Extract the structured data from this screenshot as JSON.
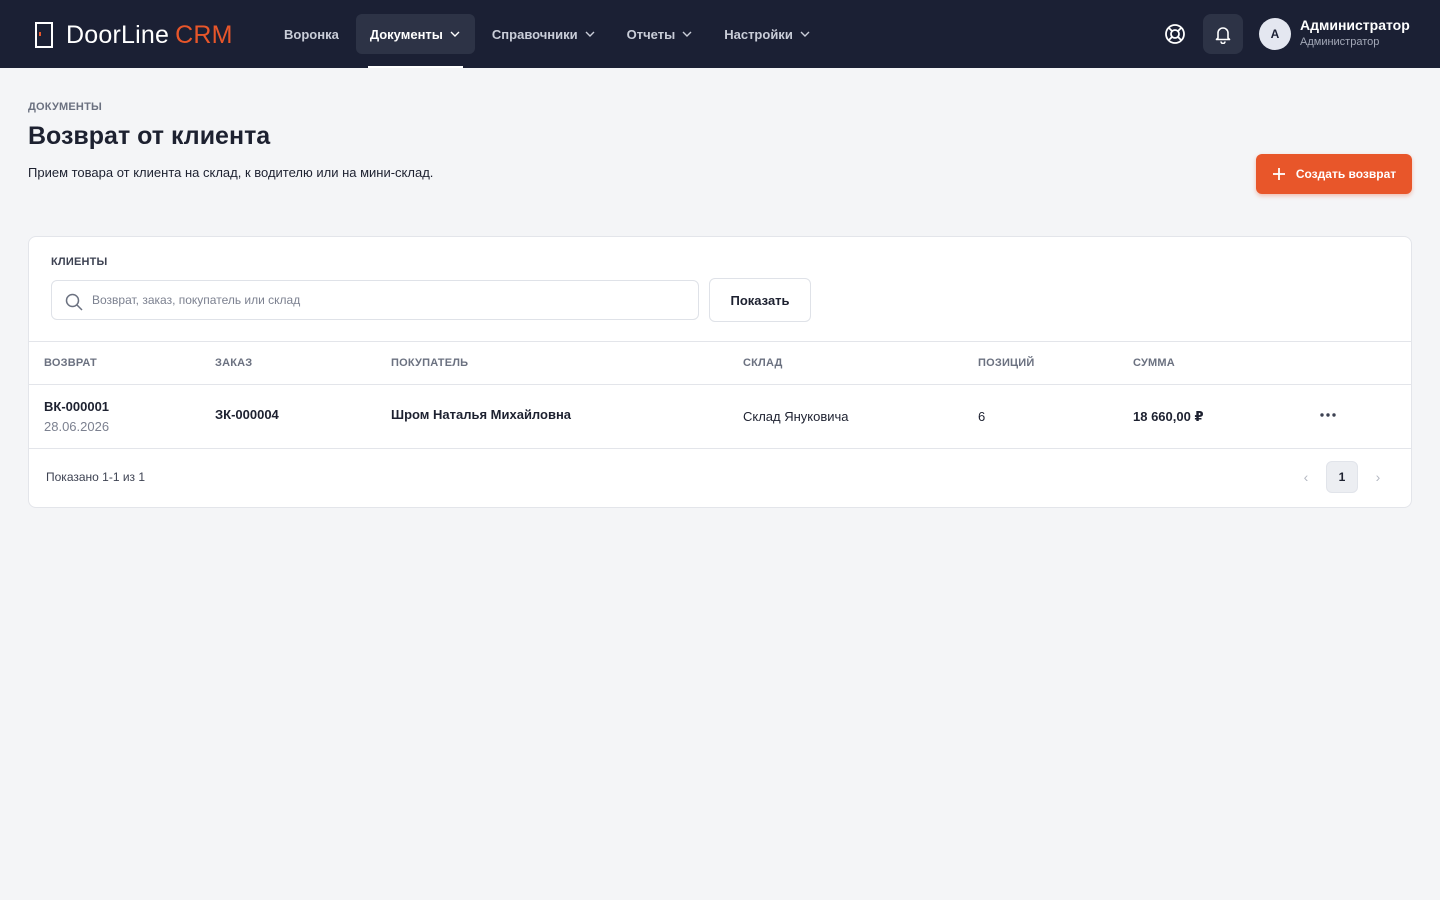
{
  "app": {
    "logo_text": "DoorLine",
    "logo_accent": "CRM"
  },
  "nav": {
    "items": [
      {
        "label": "Воронка",
        "has_dropdown": false,
        "active": false
      },
      {
        "label": "Документы",
        "has_dropdown": true,
        "active": true
      },
      {
        "label": "Справочники",
        "has_dropdown": true,
        "active": false
      },
      {
        "label": "Отчеты",
        "has_dropdown": true,
        "active": false
      },
      {
        "label": "Настройки",
        "has_dropdown": true,
        "active": false
      }
    ]
  },
  "user": {
    "initial": "A",
    "name": "Администратор",
    "role": "Администратор"
  },
  "page": {
    "breadcrumb": "ДОКУМЕНТЫ",
    "title": "Возврат от клиента",
    "subtitle": "Прием товара от клиента на склад, к водителю или на мини-склад.",
    "create_button": "Создать возврат"
  },
  "filter": {
    "label": "КЛИЕНТЫ",
    "search_placeholder": "Возврат, заказ, покупатель или склад",
    "search_value": "",
    "show_button": "Показать"
  },
  "table": {
    "columns": [
      "ВОЗВРАТ",
      "ЗАКАЗ",
      "ПОКУПАТЕЛЬ",
      "СКЛАД",
      "ПОЗИЦИЙ",
      "СУММА"
    ],
    "rows": [
      {
        "return_no": "ВК-000001",
        "date": "28.06.2026",
        "order_no": "ЗК-000004",
        "customer": "Шром Наталья Михайловна",
        "warehouse": "Склад Януковича",
        "positions": "6",
        "sum": "18 660,00 ₽"
      }
    ]
  },
  "pagination": {
    "info": "Показано 1-1 из 1",
    "prev": "‹",
    "current": "1",
    "next": "›"
  },
  "colors": {
    "topbar": "#1b2034",
    "accent": "#e8562a",
    "background": "#f4f5f7"
  }
}
